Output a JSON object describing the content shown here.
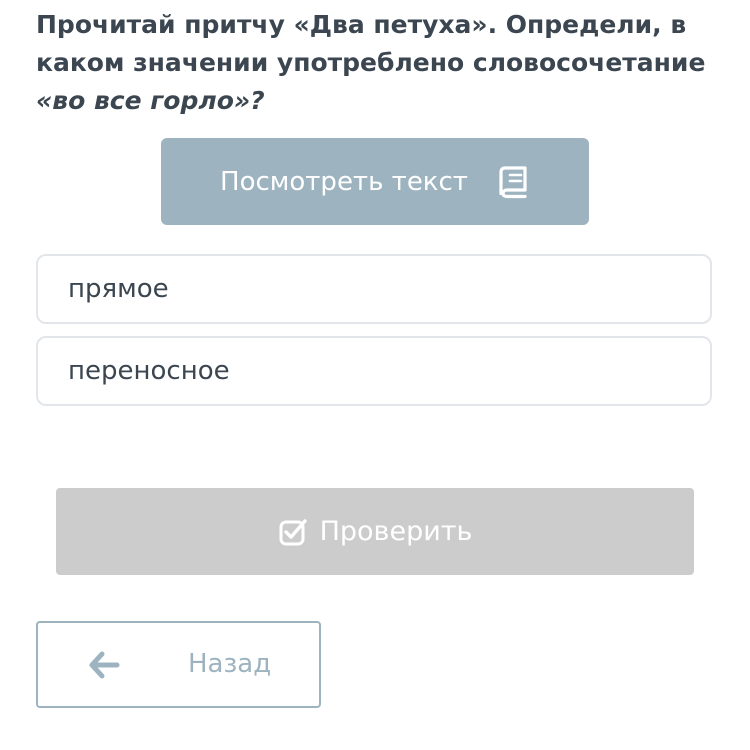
{
  "question": {
    "text": "Прочитай притчу «Два петуха». Определи, в каком значении употреблено словосочетание ",
    "emphasis": "«во все горло»?"
  },
  "view_text_button": {
    "label": "Посмотреть текст",
    "icon": "book-icon"
  },
  "options": [
    {
      "label": "прямое"
    },
    {
      "label": "переносное"
    }
  ],
  "check_button": {
    "label": "Проверить",
    "icon": "checkbox-icon"
  },
  "back_button": {
    "label": "Назад",
    "icon": "arrow-left-icon"
  },
  "colors": {
    "text": "#3b4650",
    "accent": "#9db4c0",
    "disabled": "#cccccc",
    "border": "#e2e6ea"
  }
}
